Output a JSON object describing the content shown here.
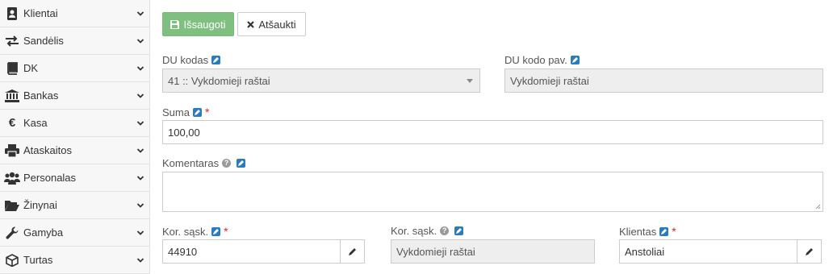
{
  "sidebar": {
    "items": [
      {
        "label": "Klientai",
        "icon": "address-book-icon"
      },
      {
        "label": "Sandėlis",
        "icon": "exchange-arrows-icon"
      },
      {
        "label": "DK",
        "icon": "book-icon"
      },
      {
        "label": "Bankas",
        "icon": "bank-icon"
      },
      {
        "label": "Kasa",
        "icon": "euro-icon"
      },
      {
        "label": "Ataskaitos",
        "icon": "printer-icon"
      },
      {
        "label": "Personalas",
        "icon": "users-icon"
      },
      {
        "label": "Žinynai",
        "icon": "folder-open-icon"
      },
      {
        "label": "Gamyba",
        "icon": "wrench-icon"
      },
      {
        "label": "Turtas",
        "icon": "cube-icon"
      }
    ]
  },
  "toolbar": {
    "save_label": "Išsaugoti",
    "cancel_label": "Atšaukti"
  },
  "form": {
    "du_kodas": {
      "label": "DU kodas",
      "value": "41 :: Vykdomieji raštai"
    },
    "du_kodo_pav": {
      "label": "DU kodo pav.",
      "value": "Vykdomieji raštai"
    },
    "suma": {
      "label": "Suma",
      "required": "*",
      "value": "100,00"
    },
    "komentaras": {
      "label": "Komentaras",
      "value": ""
    },
    "kor_sask": {
      "label": "Kor. sąsk.",
      "required": "*",
      "value": "44910"
    },
    "kor_sask_pav": {
      "label": "Kor. sąsk.",
      "value": "Vykdomieji raštai"
    },
    "klientas": {
      "label": "Klientas",
      "required": "*",
      "value": "Anstoliai"
    }
  },
  "colors": {
    "save_button": "#7fbf7f",
    "edit_icon": "#2b7bbf",
    "required": "#d9262a",
    "readonly_bg": "#eeeeee"
  }
}
